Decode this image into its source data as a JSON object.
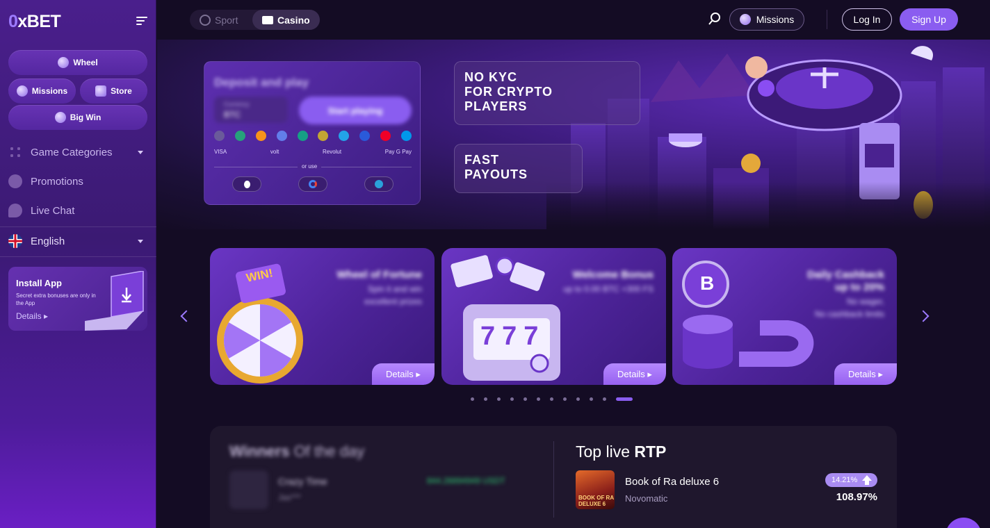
{
  "brand": {
    "logo_prefix": "0",
    "logo_rest": "xBET"
  },
  "sidebar": {
    "quick": {
      "wheel": "Wheel",
      "missions": "Missions",
      "store": "Store",
      "big_win": "Big Win"
    },
    "nav": [
      {
        "label": "Game Categories",
        "icon": "grid-icon"
      },
      {
        "label": "Promotions",
        "icon": "promo-icon"
      },
      {
        "label": "Live Chat",
        "icon": "chat-icon"
      }
    ],
    "language": "English",
    "install": {
      "title": "Install App",
      "subtitle": "Secret extra bonuses are only in the App",
      "details": "Details"
    }
  },
  "header": {
    "tabs": {
      "sport": "Sport",
      "casino": "Casino"
    },
    "missions": "Missions",
    "login": "Log In",
    "signup": "Sign Up"
  },
  "banner": {
    "deposit_title": "Deposit and play",
    "currency_label": "Currency",
    "currency": "BTC",
    "start": "Start playing",
    "payment_row": [
      "VISA",
      "volt",
      "Revolut",
      "Pay G Pay"
    ],
    "or_use": "or use",
    "kyc": [
      "NO KYC",
      "FOR CRYPTO",
      "PLAYERS"
    ],
    "fast": [
      "FAST",
      "PAYOUTS"
    ]
  },
  "promos": [
    {
      "title": "Wheel of Fortune",
      "lines": [
        "Spin it and win",
        "excellent prizes"
      ],
      "details": "Details",
      "art": "WIN!"
    },
    {
      "title": "Welcome Bonus",
      "lines": [
        "up to 0.00 BTC +300 FS"
      ],
      "details": "Details",
      "art": "777"
    },
    {
      "title": "Daily Cashback",
      "lines": [
        "up to 20%",
        "No wager,",
        "No cashback limits"
      ],
      "details": "Details",
      "art": "B"
    }
  ],
  "carousel": {
    "count": 12,
    "active": 11
  },
  "winners": {
    "title_bold": "Winners",
    "title_rest": "Of the day",
    "game": "Crazy Time",
    "user": "Jas***",
    "amount": "844.28894949 USDT"
  },
  "rtp": {
    "title_plain": "Top live",
    "title_bold": "RTP",
    "game": "Book of Ra deluxe 6",
    "provider": "Novomatic",
    "thumb_text": "BOOK OF RA DELUXE 6",
    "change": "14.21%",
    "value": "108.97%"
  },
  "colors": {
    "accent": "#8a5df0",
    "bg": "#140c24",
    "sidebar": "#4a1f8c"
  }
}
